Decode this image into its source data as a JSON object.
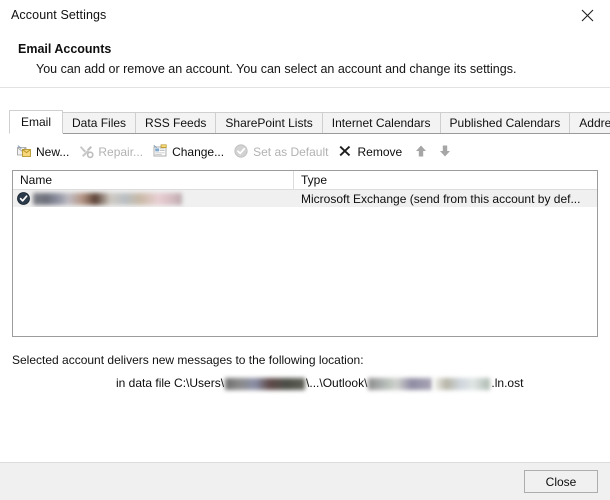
{
  "window": {
    "title": "Account Settings",
    "close_icon": "close-x-icon"
  },
  "header": {
    "title": "Email Accounts",
    "description": "You can add or remove an account. You can select an account and change its settings."
  },
  "tabs": [
    {
      "label": "Email",
      "selected": true
    },
    {
      "label": "Data Files",
      "selected": false
    },
    {
      "label": "RSS Feeds",
      "selected": false
    },
    {
      "label": "SharePoint Lists",
      "selected": false
    },
    {
      "label": "Internet Calendars",
      "selected": false
    },
    {
      "label": "Published Calendars",
      "selected": false
    },
    {
      "label": "Address Books",
      "selected": false
    }
  ],
  "toolbar": [
    {
      "label": "New...",
      "icon": "new-mail-icon",
      "enabled": true
    },
    {
      "label": "Repair...",
      "icon": "repair-tools-icon",
      "enabled": false
    },
    {
      "label": "Change...",
      "icon": "change-account-icon",
      "enabled": true
    },
    {
      "label": "Set as Default",
      "icon": "set-default-check-icon",
      "enabled": false
    },
    {
      "label": "Remove",
      "icon": "remove-x-icon",
      "enabled": true
    }
  ],
  "toolbar_arrows": {
    "up_icon": "move-up-arrow-icon",
    "down_icon": "move-down-arrow-icon"
  },
  "account_list": {
    "columns": [
      "Name",
      "Type"
    ],
    "rows": [
      {
        "name": "",
        "name_redacted": true,
        "default_icon": "default-account-check-icon",
        "type": "Microsoft Exchange (send from this account by def..."
      }
    ]
  },
  "delivery": {
    "label": "Selected account delivers new messages to the following location:",
    "location_redacted": true,
    "path_prefix": "in data file C:\\Users\\",
    "path_middle": "\\...\\Outlook\\",
    "path_suffix": ".ln.ost"
  },
  "footer": {
    "close_label": "Close"
  },
  "colors": {
    "dialog_bg": "#ffffff",
    "footer_bg": "#f0f0f0",
    "border": "#9c9c9c",
    "tab_inactive_bg": "#f3f3f3",
    "disabled_text": "#b2b2b2"
  }
}
